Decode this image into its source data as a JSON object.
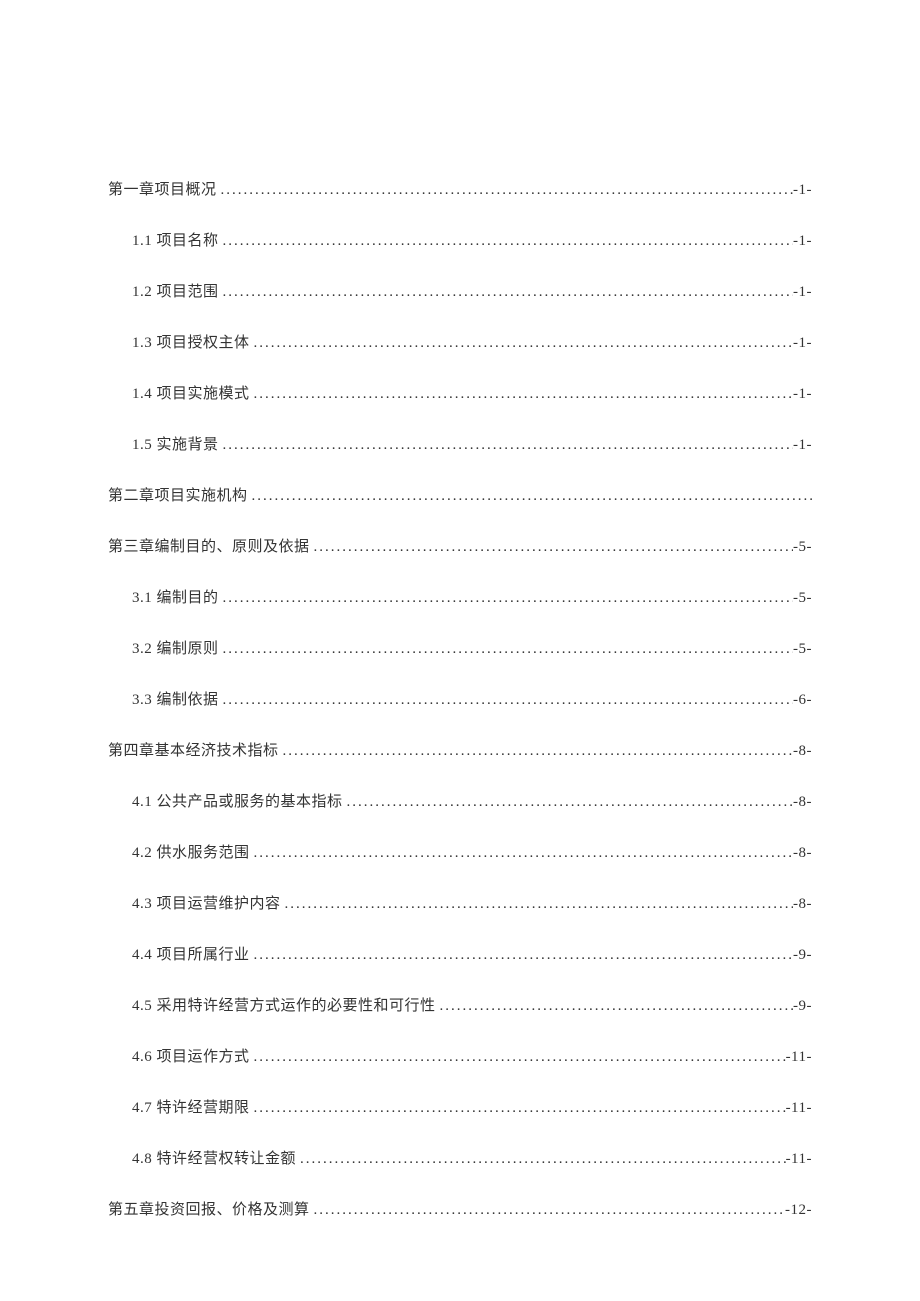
{
  "toc": [
    {
      "level": "chapter",
      "label": "第一章项目概况",
      "page": "-1-"
    },
    {
      "level": "section",
      "label": "1.1 项目名称",
      "page": "-1-"
    },
    {
      "level": "section",
      "label": "1.2 项目范围",
      "page": "-1-"
    },
    {
      "level": "section",
      "label": "1.3 项目授权主体",
      "page": "-1-"
    },
    {
      "level": "section",
      "label": "1.4 项目实施模式",
      "page": "-1-"
    },
    {
      "level": "section",
      "label": "1.5 实施背景",
      "page": "-1-"
    },
    {
      "level": "chapter",
      "label": "第二章项目实施机构",
      "page": ""
    },
    {
      "level": "chapter",
      "label": "第三章编制目的、原则及依据",
      "page": "-5-"
    },
    {
      "level": "section",
      "label": "3.1 编制目的",
      "page": "-5-"
    },
    {
      "level": "section",
      "label": "3.2 编制原则",
      "page": "-5-"
    },
    {
      "level": "section",
      "label": "3.3 编制依据",
      "page": "-6-"
    },
    {
      "level": "chapter",
      "label": "第四章基本经济技术指标",
      "page": "-8-"
    },
    {
      "level": "section",
      "label": "4.1 公共产品或服务的基本指标",
      "page": "-8-"
    },
    {
      "level": "section",
      "label": "4.2 供水服务范围",
      "page": "-8-"
    },
    {
      "level": "section",
      "label": "4.3 项目运营维护内容",
      "page": "-8-"
    },
    {
      "level": "section",
      "label": "4.4 项目所属行业",
      "page": "-9-"
    },
    {
      "level": "section",
      "label": "4.5 采用特许经营方式运作的必要性和可行性",
      "page": "-9-"
    },
    {
      "level": "section",
      "label": "4.6 项目运作方式",
      "page": "-11-"
    },
    {
      "level": "section",
      "label": "4.7 特许经营期限",
      "page": "-11-"
    },
    {
      "level": "section",
      "label": "4.8 特许经营权转让金额",
      "page": "-11-"
    },
    {
      "level": "chapter",
      "label": "第五章投资回报、价格及测算",
      "page": "-12-"
    }
  ]
}
